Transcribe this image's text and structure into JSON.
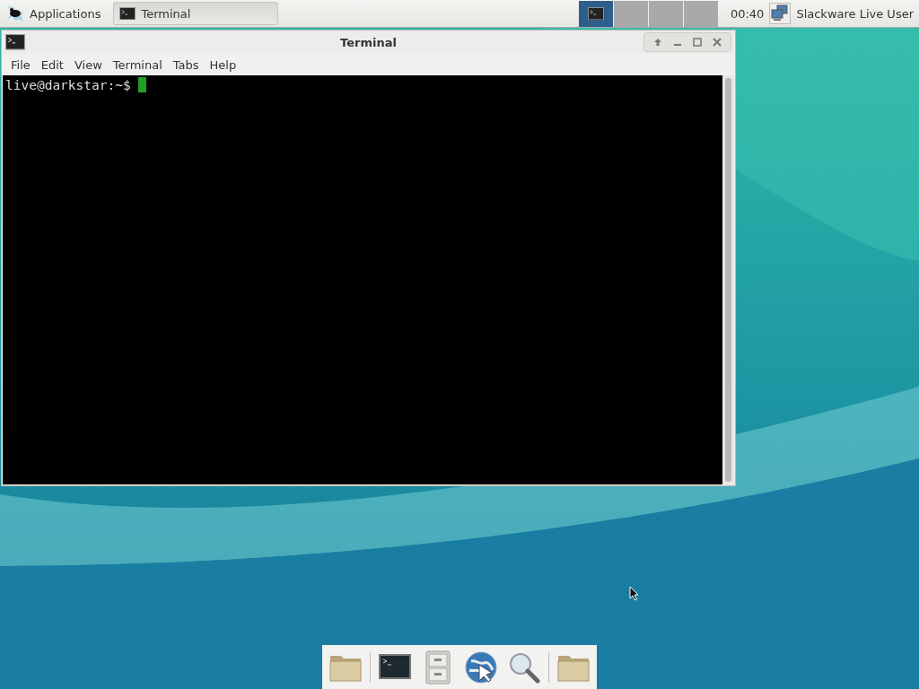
{
  "panel": {
    "menu": "Applications",
    "tasks": [
      {
        "label": "Terminal",
        "selected": true
      }
    ],
    "workspaces": [
      {
        "selected": true
      },
      {
        "selected": false
      },
      {
        "selected": false
      },
      {
        "selected": false
      }
    ],
    "clock": "00:40",
    "user": "Slackware Live User"
  },
  "window": {
    "title": "Terminal",
    "menu": [
      "File",
      "Edit",
      "View",
      "Terminal",
      "Tabs",
      "Help"
    ],
    "prompt": "live@darkstar:~$ "
  },
  "dock": {
    "groups": [
      [
        {
          "kind": "home"
        }
      ],
      [
        {
          "kind": "terminal"
        },
        {
          "kind": "cabinet"
        },
        {
          "kind": "globe"
        },
        {
          "kind": "search"
        }
      ],
      [
        {
          "kind": "folder"
        }
      ]
    ]
  }
}
